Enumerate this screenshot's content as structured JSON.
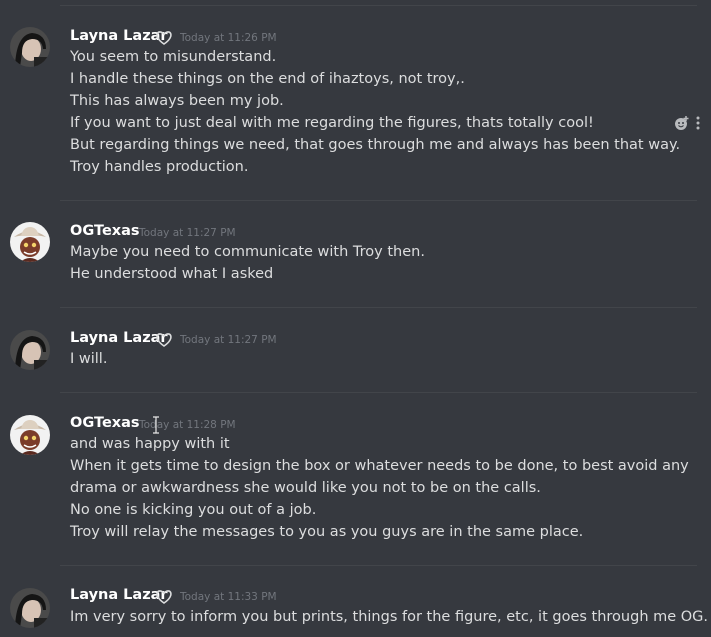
{
  "messages": [
    {
      "author": "Layna Lazar",
      "timestamp": "Today at 11:26 PM",
      "lines": [
        "You seem to misunderstand.",
        "I handle these things on the end of ihaztoys, not troy,.",
        "This has always been my job.",
        "If you want to just deal with me regarding the figures, thats totally cool!",
        "But regarding things we need, that goes through me and always has been that way.",
        "Troy handles production."
      ]
    },
    {
      "author": "OGTexas",
      "timestamp": "Today at 11:27 PM",
      "lines": [
        "Maybe you need to communicate with Troy then.",
        "He understood what I asked"
      ]
    },
    {
      "author": "Layna Lazar",
      "timestamp": "Today at 11:27 PM",
      "lines": [
        "I will."
      ]
    },
    {
      "author": "OGTexas",
      "timestamp": "Today at 11:28 PM",
      "lines": [
        "and was happy with it",
        "When it gets time to design the box or whatever needs to be done, to best avoid any",
        "drama or awkwardness she would like you not to be on the calls.",
        "No one is kicking you out of a job.",
        "Troy will relay the messages to you as you guys are in the same place."
      ]
    },
    {
      "author": "Layna Lazar",
      "timestamp": "Today at 11:33 PM",
      "lines": [
        "Im very sorry to inform you but prints, things for the figure, etc, it goes through me OG."
      ]
    }
  ],
  "icons": {
    "add_reaction": "add-reaction-icon",
    "more": "more-options-icon",
    "badge": "heart-badge-icon"
  },
  "colors": {
    "background": "#36393f",
    "username": "#ffffff",
    "timestamp": "#72767d",
    "text": "#dcddde",
    "divider": "#42454a"
  }
}
